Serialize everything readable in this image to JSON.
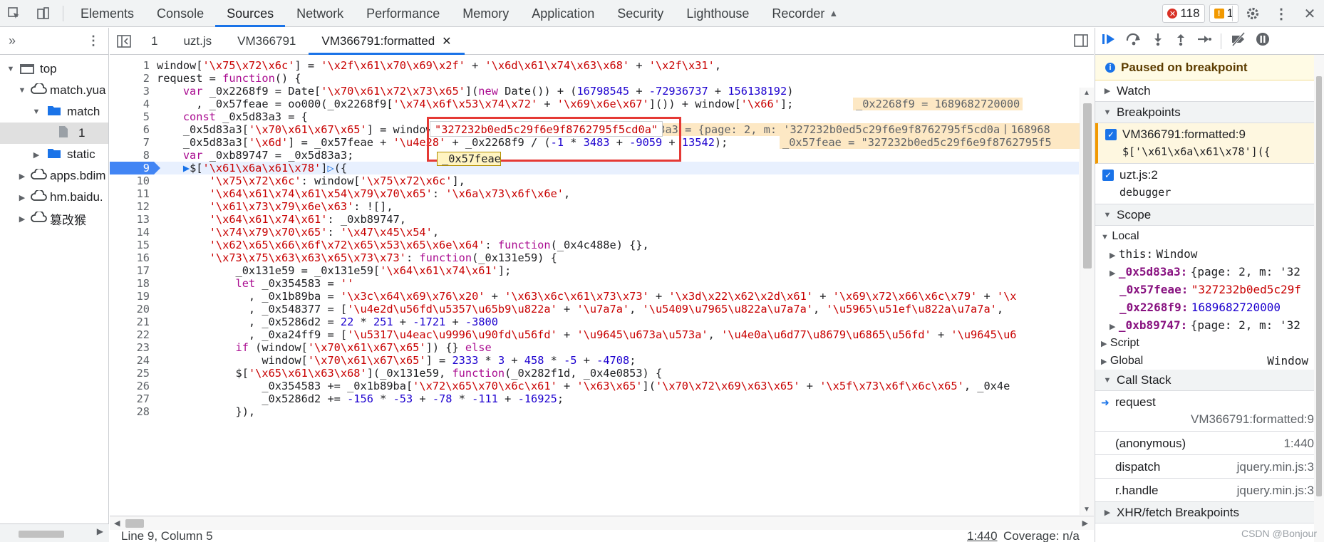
{
  "devtools": {
    "tabs": [
      "Elements",
      "Console",
      "Sources",
      "Network",
      "Performance",
      "Memory",
      "Application",
      "Security",
      "Lighthouse",
      "Recorder"
    ],
    "active_tab": "Sources",
    "error_count": "118",
    "warning_count": "1"
  },
  "navigator": {
    "tree": [
      {
        "label": "top",
        "icon": "frame-icon"
      },
      {
        "label": "match.yua",
        "icon": "cloud-icon"
      },
      {
        "label": "match",
        "icon": "folder-icon"
      },
      {
        "label": "1",
        "icon": "file-icon"
      },
      {
        "label": "static",
        "icon": "folder-icon"
      },
      {
        "label": "apps.bdim",
        "icon": "cloud-icon"
      },
      {
        "label": "hm.baidu.",
        "icon": "cloud-icon"
      },
      {
        "label": "篡改猴",
        "icon": "cloud-icon"
      }
    ]
  },
  "editor": {
    "tabs": [
      "1",
      "uzt.js",
      "VM366791",
      "VM366791:formatted"
    ],
    "active_tab": "VM366791:formatted",
    "tooltip": "\"327232b0ed5c29f6e9f8762795f5cd0a\"",
    "hover_token": "_0x57feae",
    "inline_values": {
      "l4": "_0x2268f9 = 1689682720000",
      "l6": "_0x5d83a3 = {page: 2, m: '327232b0ed5c29f6e9f8762795f5cd0a丨168968",
      "l7": "_0x57feae = \"327232b0ed5c29f6e9f8762795f5"
    },
    "status": {
      "position": "Line 9, Column 5",
      "location_link": "1:440",
      "coverage": "Coverage: n/a"
    }
  },
  "debugger": {
    "paused_text": "Paused on breakpoint",
    "sections": {
      "watch": "Watch",
      "breakpoints": "Breakpoints",
      "scope": "Scope",
      "call_stack": "Call Stack",
      "xhr": "XHR/fetch Breakpoints"
    },
    "breakpoints": [
      {
        "file": "VM366791:formatted:9",
        "code": "$['\\x61\\x6a\\x61\\x78']({"
      },
      {
        "file": "uzt.js:2",
        "code": "debugger"
      }
    ],
    "scope": {
      "local_label": "Local",
      "this_key": "this:",
      "this_val": "Window",
      "vars": [
        {
          "name": "_0x5d83a3:",
          "value": "{page: 2, m: '32"
        },
        {
          "name": "_0x57feae:",
          "value": "\"327232b0ed5c29f"
        },
        {
          "name": "_0x2268f9:",
          "value": "1689682720000"
        },
        {
          "name": "_0xb89747:",
          "value": "{page: 2, m: '32"
        }
      ],
      "script_label": "Script",
      "global_label": "Global",
      "global_val": "Window"
    },
    "call_stack": [
      {
        "fn": "request",
        "loc": "VM366791:formatted:9"
      },
      {
        "fn": "(anonymous)",
        "loc": "1:440"
      },
      {
        "fn": "dispatch",
        "loc": "jquery.min.js:3"
      },
      {
        "fn": "r.handle",
        "loc": "jquery.min.js:3"
      }
    ]
  },
  "watermark": "CSDN @Bonjour",
  "colors": {
    "accent": "#1a73e8",
    "highlight_box": "#e53935",
    "paused_bg": "#fffbe5"
  }
}
